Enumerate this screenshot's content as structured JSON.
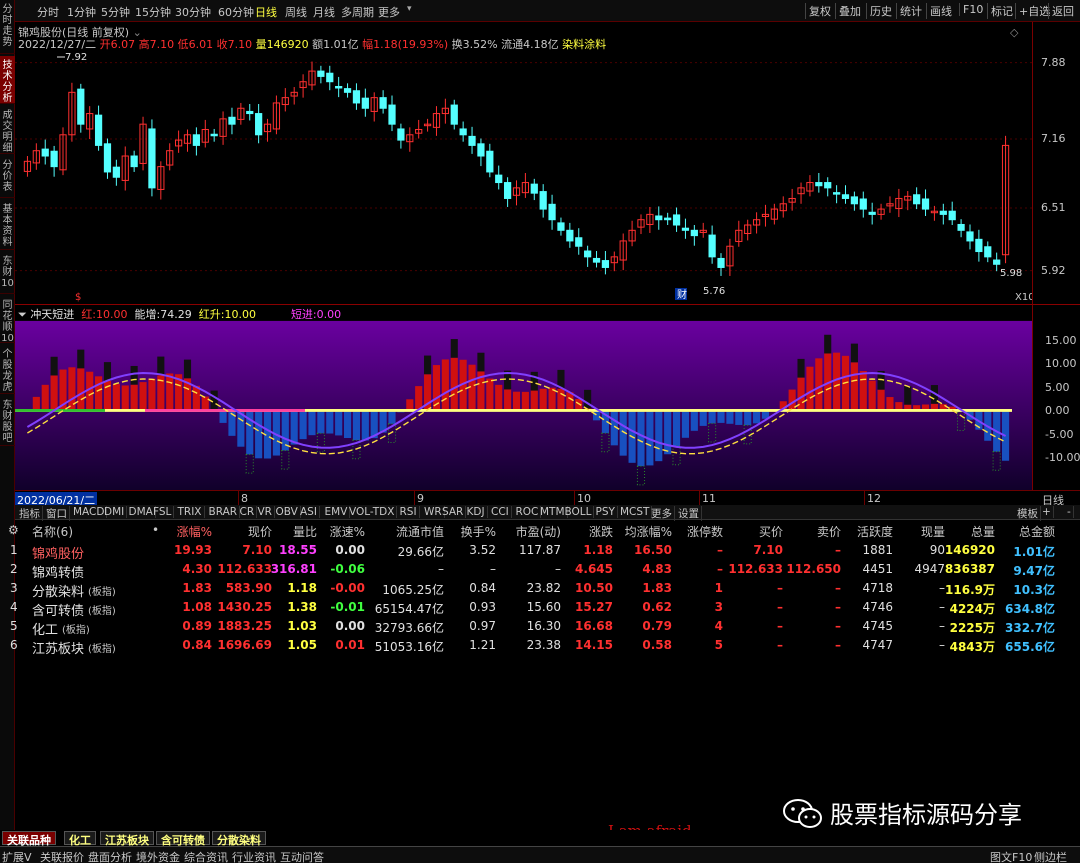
{
  "left_nav": [
    "分时走势",
    "技术分析",
    "成交明细",
    "分价表",
    "基本资料",
    "东财10",
    "同花顺10",
    "个股龙虎",
    "东财股吧"
  ],
  "toolbar": {
    "periods": [
      "分时",
      "1分钟",
      "5分钟",
      "15分钟",
      "30分钟",
      "60分钟",
      "日线",
      "周线",
      "月线",
      "多周期",
      "更多"
    ],
    "active_period": "日线",
    "right_buttons": [
      "复权",
      "叠加",
      "历史",
      "统计",
      "画线",
      "F10",
      "标记",
      "+自选",
      "返回"
    ]
  },
  "stock": {
    "title": "锦鸡股份(日线 前复权)",
    "date": "2022/12/27/二",
    "open_label": "开",
    "open": "6.07",
    "high_label": "高",
    "high": "7.10",
    "low_label": "低",
    "low": "6.01",
    "close_label": "收",
    "close": "7.10",
    "volume_label": "量",
    "volume": "146920",
    "amount_label": "额",
    "amount": "1.01亿",
    "change_label": "幅",
    "change": "1.18(19.93%)",
    "turnover_label": "换",
    "turnover": "3.52%",
    "float_label": "流通",
    "float": "4.18亿",
    "concept": "染料涂料"
  },
  "price_axis": [
    "7.88",
    "7.16",
    "6.51",
    "5.92"
  ],
  "price_marks": {
    "high_mark": "7.92",
    "low_mark": "5.76",
    "last_mark": "5.98",
    "fin_badge": "财",
    "dollar_badge": "$",
    "x10": "X10"
  },
  "indicator": {
    "name": "冲天短进",
    "red_label": "红:",
    "red_value": "10.00",
    "energy_label": "能增:",
    "energy_value": "74.29",
    "redup_label": "红升:",
    "redup_value": "10.00",
    "short_label": "短进:",
    "short_value": "0.00",
    "axis": [
      "15.00",
      "10.00",
      "5.00",
      "0.00",
      "-5.00",
      "-10.00"
    ]
  },
  "date_axis": {
    "start": "2022/06/21/二",
    "months": [
      "8",
      "9",
      "10",
      "11",
      "12"
    ],
    "right_label": "日线"
  },
  "indicator_tabs": [
    "指标",
    "窗口",
    "MACD",
    "DMI",
    "DMA",
    "FSL",
    "TRIX",
    "BRAR",
    "CR",
    "VR",
    "OBV",
    "ASI",
    "EMV",
    "VOL-TDX",
    "RSI",
    "WR",
    "SAR",
    "KDJ",
    "CCI",
    "ROC",
    "MTM",
    "BOLL",
    "PSY",
    "MCST",
    "更多",
    "设置"
  ],
  "indicator_tabs_right": [
    "模板",
    "+",
    "-"
  ],
  "table": {
    "headers": [
      "名称(6)",
      "•",
      "涨幅%",
      "现价",
      "量比",
      "涨速%",
      "流通市值",
      "换手%",
      "市盈(动)",
      "涨跌",
      "均涨幅%",
      "涨停数",
      "买价",
      "卖价",
      "活跃度",
      "现量",
      "总量",
      "总金额"
    ],
    "rows": [
      {
        "idx": "1",
        "name": "锦鸡股份",
        "tag": "",
        "chg": "19.93",
        "price": "7.10",
        "vr": "18.55",
        "speed": "0.00",
        "mcap": "29.66亿",
        "turn": "3.52",
        "pe": "117.87",
        "diff": "1.18",
        "avg": "16.50",
        "limit": "–",
        "bid": "7.10",
        "ask": "–",
        "act": "1881",
        "cur": "90",
        "vol": "146920",
        "amt": "1.01亿"
      },
      {
        "idx": "2",
        "name": "锦鸡转债",
        "tag": "",
        "chg": "4.30",
        "price": "112.633",
        "vr": "316.81",
        "speed": "-0.06",
        "mcap": "–",
        "turn": "–",
        "pe": "–",
        "diff": "4.645",
        "avg": "4.83",
        "limit": "–",
        "bid": "112.633",
        "ask": "112.650",
        "act": "4451",
        "cur": "4947",
        "vol": "836387",
        "amt": "9.47亿"
      },
      {
        "idx": "3",
        "name": "分散染料",
        "tag": "(板指)",
        "chg": "1.83",
        "price": "583.90",
        "vr": "1.18",
        "speed": "-0.00",
        "mcap": "1065.25亿",
        "turn": "0.84",
        "pe": "23.82",
        "diff": "10.50",
        "avg": "1.83",
        "limit": "1",
        "bid": "–",
        "ask": "–",
        "act": "4718",
        "cur": "–",
        "vol": "116.9万",
        "amt": "10.3亿"
      },
      {
        "idx": "4",
        "name": "含可转债",
        "tag": "(板指)",
        "chg": "1.08",
        "price": "1430.25",
        "vr": "1.38",
        "speed": "-0.01",
        "mcap": "65154.47亿",
        "turn": "0.93",
        "pe": "15.60",
        "diff": "15.27",
        "avg": "0.62",
        "limit": "3",
        "bid": "–",
        "ask": "–",
        "act": "4746",
        "cur": "–",
        "vol": "4224万",
        "amt": "634.8亿"
      },
      {
        "idx": "5",
        "name": "化工",
        "tag": "(板指)",
        "chg": "0.89",
        "price": "1883.25",
        "vr": "1.03",
        "speed": "0.00",
        "mcap": "32793.66亿",
        "turn": "0.97",
        "pe": "16.30",
        "diff": "16.68",
        "avg": "0.79",
        "limit": "4",
        "bid": "–",
        "ask": "–",
        "act": "4745",
        "cur": "–",
        "vol": "2225万",
        "amt": "332.7亿"
      },
      {
        "idx": "6",
        "name": "江苏板块",
        "tag": "(板指)",
        "chg": "0.84",
        "price": "1696.69",
        "vr": "1.05",
        "speed": "0.01",
        "mcap": "51053.16亿",
        "turn": "1.21",
        "pe": "23.38",
        "diff": "14.15",
        "avg": "0.58",
        "limit": "5",
        "bid": "–",
        "ask": "–",
        "act": "4747",
        "cur": "–",
        "vol": "4843万",
        "amt": "655.6亿"
      }
    ]
  },
  "bottom_tabs": [
    "关联品种",
    "化工",
    "江苏板块",
    "含可转债",
    "分散染料"
  ],
  "status_bar": [
    "扩展V",
    "关联报价",
    "盘面分析",
    "境外资金",
    "综合资讯",
    "行业资讯",
    "互动问答"
  ],
  "status_right": "图文F10",
  "status_right2": "侧边栏",
  "watermark": "股票指标源码分享",
  "overlay_text": "I am afraid",
  "colors": {
    "up": "#ff3030",
    "down": "#54ffff",
    "yellow": "#ffff40",
    "magenta": "#ff40ff",
    "green": "#40ff40",
    "panel_purple": "#5a0080",
    "bar_red": "#d01010",
    "bar_blue": "#1850c0"
  },
  "chart_data": {
    "type": "candlestick",
    "note": "",
    "closes": [
      6.95,
      7.05,
      7.0,
      6.9,
      7.2,
      7.6,
      7.3,
      7.4,
      7.1,
      6.85,
      6.8,
      7.0,
      6.9,
      7.3,
      6.7,
      6.9,
      7.05,
      7.15,
      7.2,
      7.1,
      7.25,
      7.2,
      7.35,
      7.3,
      7.45,
      7.4,
      7.2,
      7.3,
      7.5,
      7.55,
      7.6,
      7.7,
      7.8,
      7.75,
      7.7,
      7.65,
      7.6,
      7.5,
      7.45,
      7.55,
      7.45,
      7.3,
      7.15,
      7.2,
      7.25,
      7.3,
      7.4,
      7.45,
      7.3,
      7.2,
      7.1,
      7.0,
      6.85,
      6.75,
      6.6,
      6.7,
      6.75,
      6.65,
      6.5,
      6.4,
      6.3,
      6.2,
      6.15,
      6.05,
      6.0,
      5.95,
      6.05,
      6.2,
      6.3,
      6.4,
      6.45,
      6.4,
      6.4,
      6.35,
      6.3,
      6.25,
      6.3,
      6.05,
      5.95,
      6.15,
      6.3,
      6.35,
      6.4,
      6.45,
      6.5,
      6.55,
      6.6,
      6.7,
      6.75,
      6.72,
      6.7,
      6.65,
      6.6,
      6.55,
      6.5,
      6.45,
      6.5,
      6.55,
      6.6,
      6.62,
      6.55,
      6.5,
      6.48,
      6.45,
      6.4,
      6.3,
      6.2,
      6.1,
      6.05,
      5.98,
      7.1
    ],
    "yrange": [
      5.7,
      7.98
    ]
  }
}
